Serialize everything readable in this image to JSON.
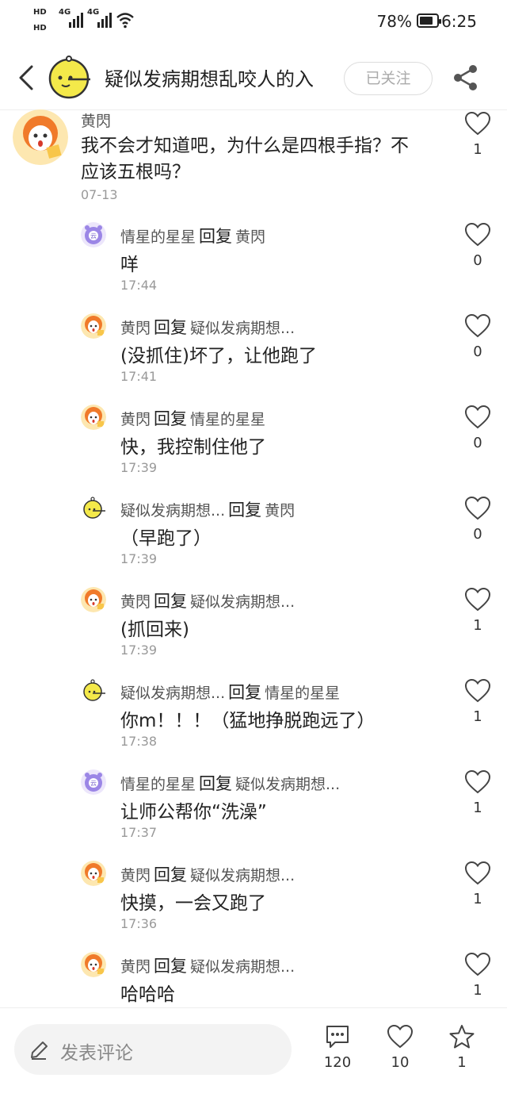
{
  "status": {
    "hd1": "HD",
    "hd2": "HD",
    "net1": "4G",
    "net2": "4G",
    "battery": "78%",
    "time": "6:25"
  },
  "header": {
    "title": "疑似发病期想乱咬人的入",
    "follow_label": "已关注"
  },
  "main_comment": {
    "author": "黄閃",
    "text": "我不会才知道吧，为什么是四根手指？不应该五根吗？",
    "date": "07-13",
    "likes": "1"
  },
  "replies": [
    {
      "avatar": "purple",
      "author": "情星的星星",
      "reply_word": "回复",
      "target": "黄閃",
      "text": "咩",
      "time": "17:44",
      "likes": "0"
    },
    {
      "avatar": "orange",
      "author": "黄閃",
      "reply_word": "回复",
      "target": "疑似发病期想...",
      "text": "(没抓住)坏了，让他跑了",
      "time": "17:41",
      "likes": "0"
    },
    {
      "avatar": "orange",
      "author": "黄閃",
      "reply_word": "回复",
      "target": "情星的星星",
      "text": "快，我控制住他了",
      "time": "17:39",
      "likes": "0"
    },
    {
      "avatar": "yellow",
      "author": "疑似发病期想...",
      "reply_word": "回复",
      "target": "黄閃",
      "text": "（早跑了）",
      "time": "17:39",
      "likes": "0"
    },
    {
      "avatar": "orange",
      "author": "黄閃",
      "reply_word": "回复",
      "target": "疑似发病期想...",
      "text": "(抓回来)",
      "time": "17:39",
      "likes": "1"
    },
    {
      "avatar": "yellow",
      "author": "疑似发病期想...",
      "reply_word": "回复",
      "target": "情星的星星",
      "text": "你m！！！（猛地挣脱跑远了）",
      "time": "17:38",
      "likes": "1"
    },
    {
      "avatar": "purple",
      "author": "情星的星星",
      "reply_word": "回复",
      "target": "疑似发病期想...",
      "text": "让师公帮你“洗澡”",
      "time": "17:37",
      "likes": "1"
    },
    {
      "avatar": "orange",
      "author": "黄閃",
      "reply_word": "回复",
      "target": "疑似发病期想...",
      "text": "快摸，一会又跑了",
      "time": "17:36",
      "likes": "1"
    },
    {
      "avatar": "orange",
      "author": "黄閃",
      "reply_word": "回复",
      "target": "疑似发病期想...",
      "text": "哈哈哈",
      "time": "",
      "likes": "1"
    }
  ],
  "bottom_bar": {
    "placeholder": "发表评论",
    "comment_count": "120",
    "like_count": "10",
    "favorite_count": "1"
  },
  "colors": {
    "orange_avatar": "#f07a2a",
    "yellow_avatar": "#f4e94a",
    "purple_avatar": "#9b86e6"
  },
  "icons": [
    "back-icon",
    "share-icon",
    "heart-icon",
    "comment-icon",
    "star-icon",
    "pen-icon"
  ]
}
